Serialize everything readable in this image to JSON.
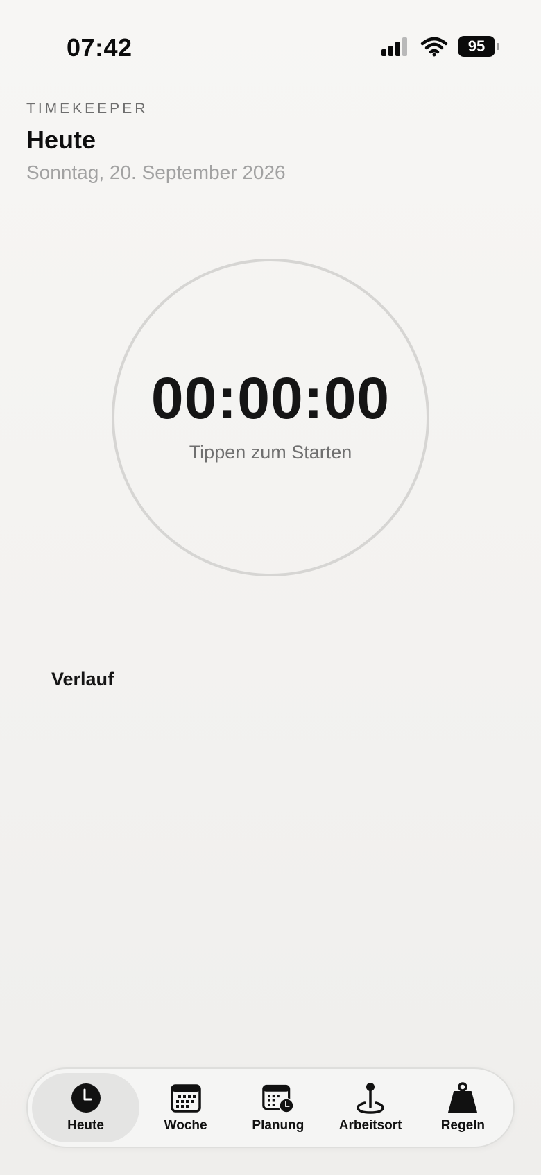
{
  "status_bar": {
    "time": "07:42",
    "battery": "95"
  },
  "header": {
    "app_name": "TIMEKEEPER",
    "title": "Heute",
    "date": "Sonntag, 20. September 2026"
  },
  "timer": {
    "value": "00:00:00",
    "hint": "Tippen zum Starten"
  },
  "history": {
    "title": "Verlauf"
  },
  "tabs": [
    {
      "label": "Heute",
      "icon": "clock-icon",
      "active": true
    },
    {
      "label": "Woche",
      "icon": "calendar-icon",
      "active": false
    },
    {
      "label": "Planung",
      "icon": "calendar-clock-icon",
      "active": false
    },
    {
      "label": "Arbeitsort",
      "icon": "map-pin-icon",
      "active": false
    },
    {
      "label": "Regeln",
      "icon": "weight-icon",
      "active": false
    }
  ]
}
